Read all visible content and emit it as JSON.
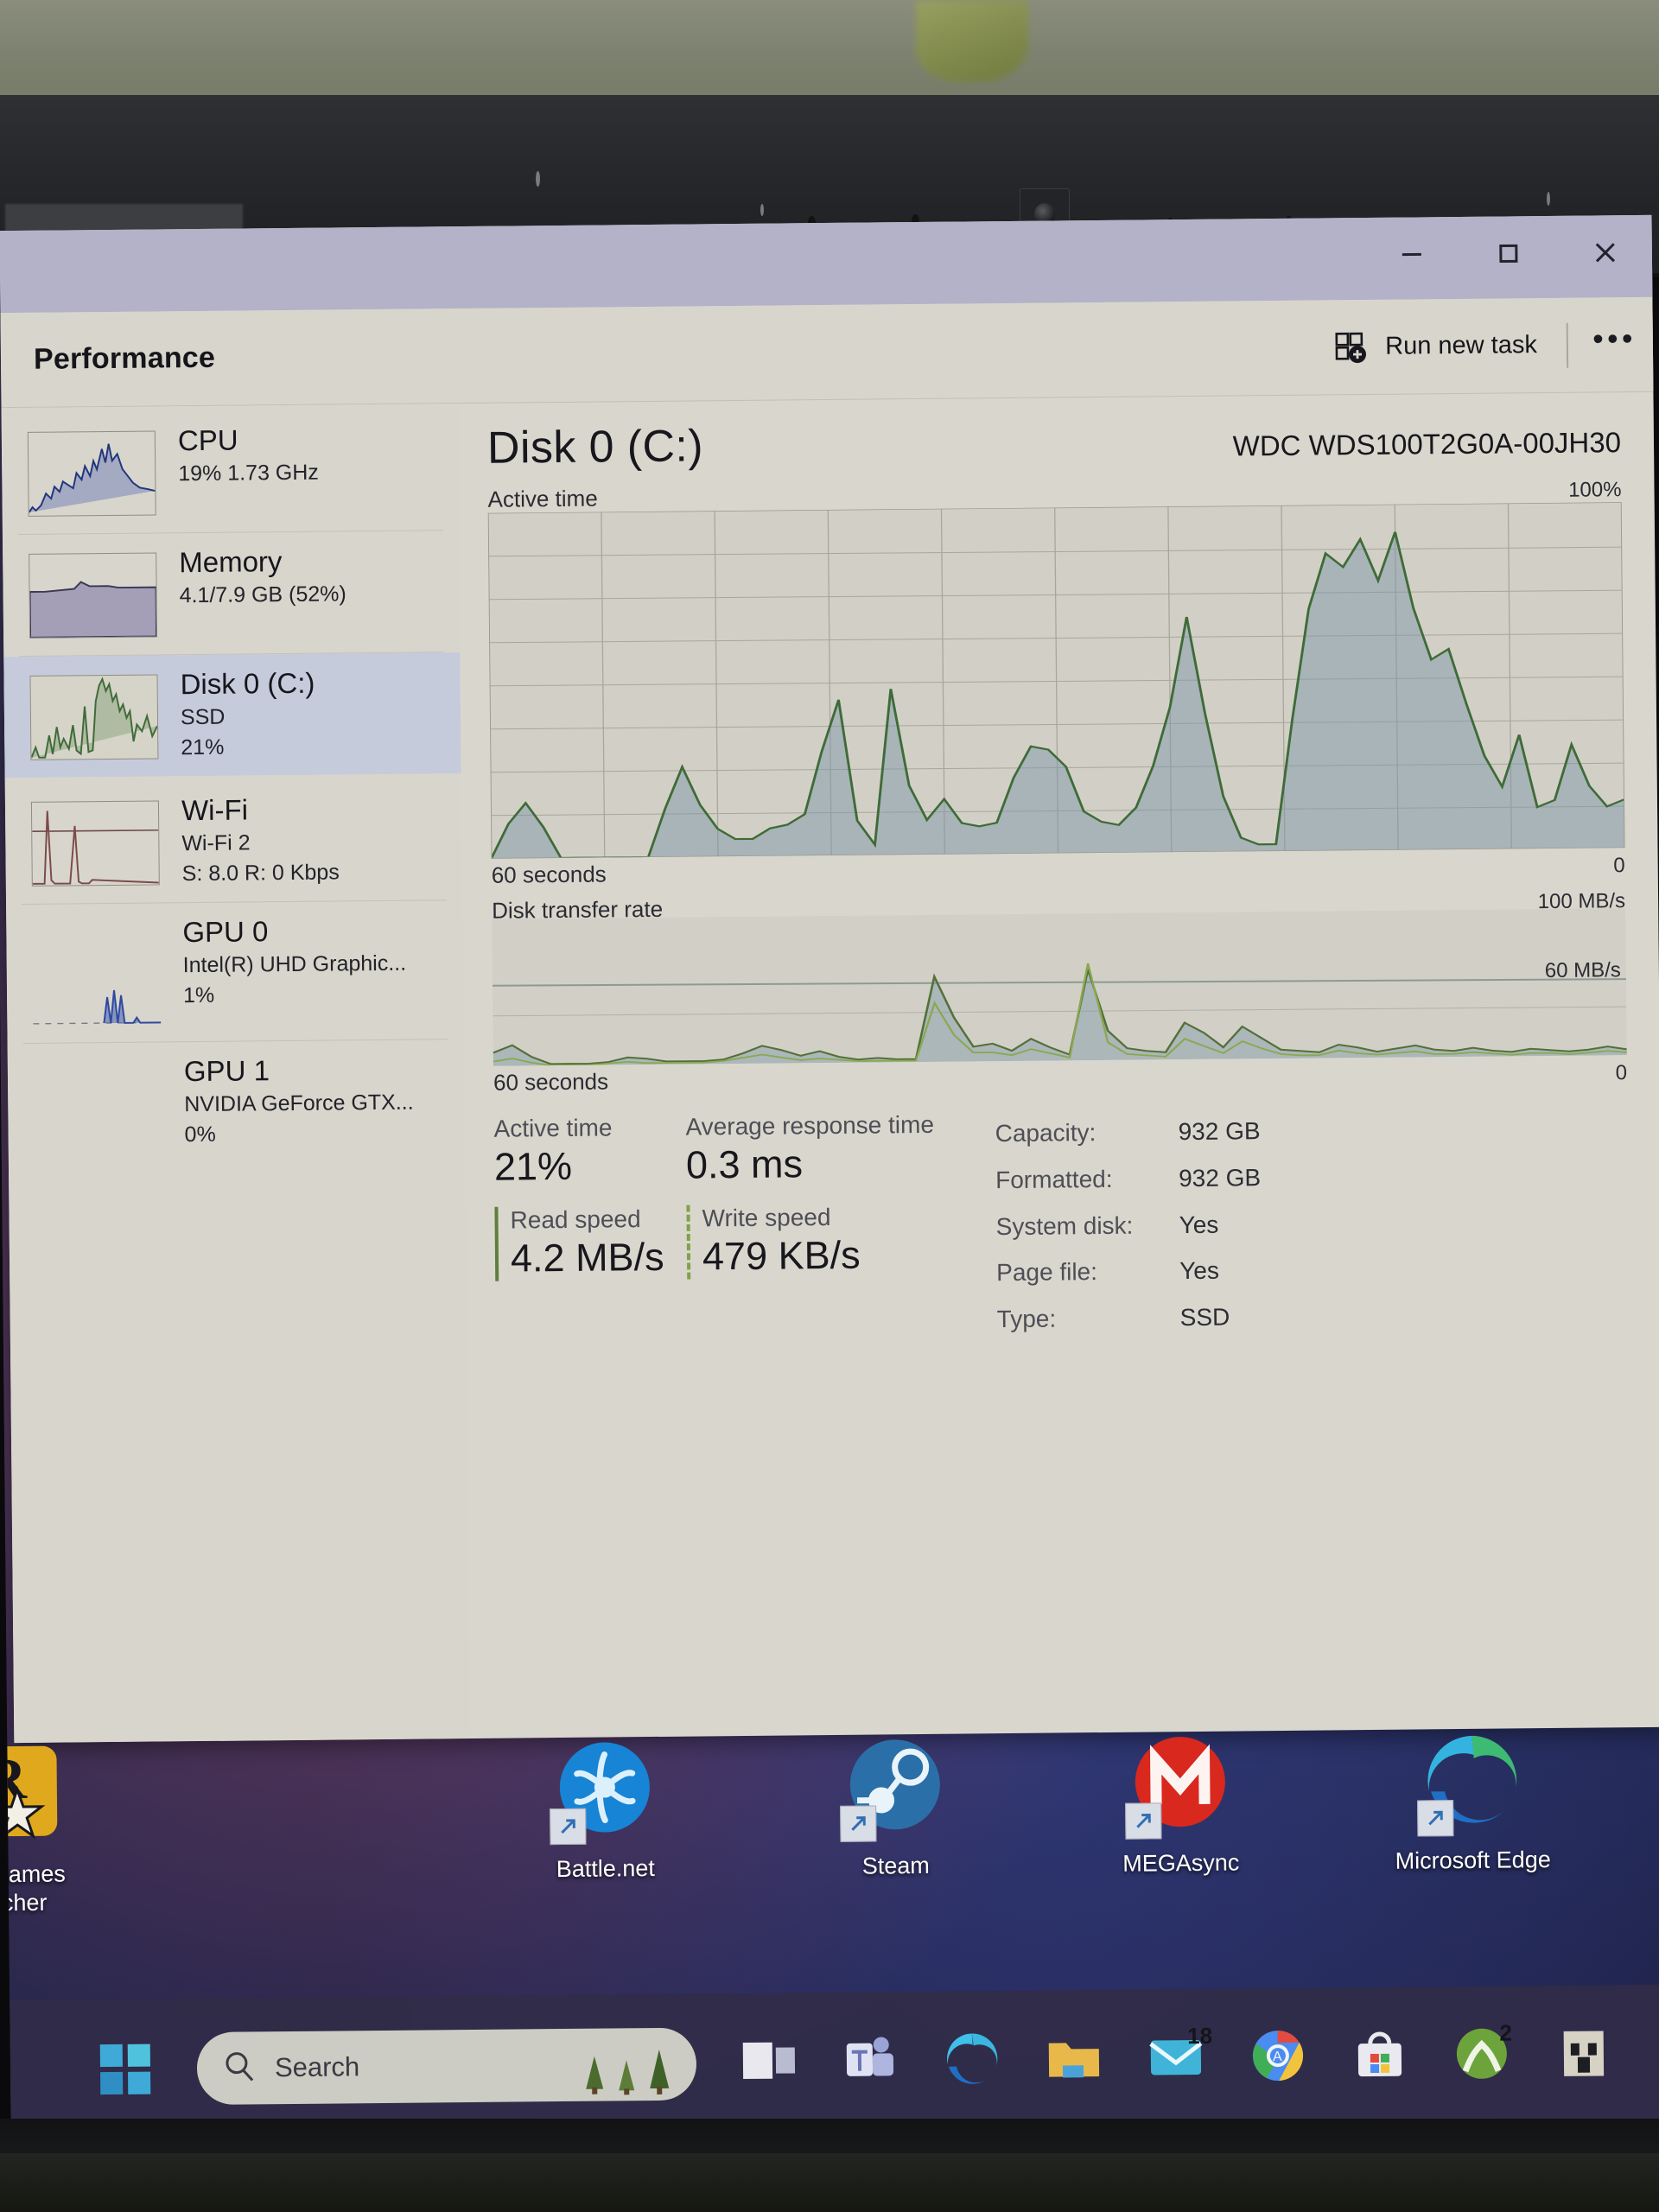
{
  "window": {
    "app_title": "Performance",
    "controls": {
      "minimize": "minimize-icon",
      "maximize": "maximize-icon",
      "close": "close-icon"
    },
    "toolbar": {
      "run_new_task_label": "Run new task",
      "run_new_task_icon": "new-task-icon",
      "more_label": "•••"
    }
  },
  "sidebar": {
    "items": [
      {
        "name": "CPU",
        "sub1": "19%  1.73 GHz",
        "sub2": "",
        "selected": false,
        "color": "#2a3f8f"
      },
      {
        "name": "Memory",
        "sub1": "4.1/7.9 GB (52%)",
        "sub2": "",
        "selected": false,
        "color": "#6a5a9a"
      },
      {
        "name": "Disk 0 (C:)",
        "sub1": "SSD",
        "sub2": "21%",
        "selected": true,
        "color": "#4e7a45"
      },
      {
        "name": "Wi-Fi",
        "sub1": "Wi-Fi 2",
        "sub2": "S: 8.0 R: 0 Kbps",
        "selected": false,
        "color": "#7a4c4c"
      },
      {
        "name": "GPU 0",
        "sub1": "Intel(R) UHD Graphic...",
        "sub2": "1%",
        "selected": false,
        "color": "#3f57a8"
      },
      {
        "name": "GPU 1",
        "sub1": "NVIDIA GeForce GTX...",
        "sub2": "0%",
        "selected": false,
        "color": "#3f57a8"
      }
    ]
  },
  "main": {
    "title": "Disk 0 (C:)",
    "model": "WDC WDS100T2G0A-00JH30",
    "active_chart": {
      "caption": "Active time",
      "max_label": "100%",
      "min_label": "0",
      "time_label": "60 seconds"
    },
    "transfer_chart": {
      "caption": "Disk transfer rate",
      "max_label": "100 MB/s",
      "mid_label": "60 MB/s",
      "min_label": "0",
      "time_label": "60 seconds"
    },
    "stats": {
      "active_time_label": "Active time",
      "active_time_value": "21%",
      "avg_response_label": "Average response time",
      "avg_response_value": "0.3 ms",
      "read_speed_label": "Read speed",
      "read_speed_value": "4.2 MB/s",
      "write_speed_label": "Write speed",
      "write_speed_value": "479 KB/s"
    },
    "properties": [
      {
        "key": "Capacity:",
        "value": "932 GB"
      },
      {
        "key": "Formatted:",
        "value": "932 GB"
      },
      {
        "key": "System disk:",
        "value": "Yes"
      },
      {
        "key": "Page file:",
        "value": "Yes"
      },
      {
        "key": "Type:",
        "value": "SSD"
      }
    ]
  },
  "chart_data": {
    "type": "area",
    "title": "Disk 0 (C:) Active time",
    "xlabel": "60 seconds",
    "ylabel": "Active time",
    "ylim": [
      0,
      100
    ],
    "grid": true,
    "series": [
      {
        "name": "Active time",
        "unit": "%",
        "color": "#4e7a45",
        "values": [
          0,
          10,
          16,
          9,
          0,
          0,
          0,
          0,
          0,
          0,
          14,
          26,
          15,
          8,
          5,
          5,
          8,
          9,
          12,
          30,
          45,
          10,
          3,
          48,
          20,
          10,
          16,
          9,
          8,
          9,
          22,
          31,
          30,
          25,
          12,
          9,
          8,
          13,
          25,
          42,
          68,
          40,
          16,
          4,
          2,
          2,
          38,
          70,
          86,
          82,
          90,
          78,
          92,
          70,
          55,
          58,
          42,
          27,
          18,
          33,
          12,
          14,
          30,
          18,
          12,
          14
        ]
      }
    ],
    "secondary": {
      "type": "area",
      "title": "Disk transfer rate",
      "xlabel": "60 seconds",
      "ylim": [
        0,
        100
      ],
      "y_ticks": [
        0,
        60,
        100
      ],
      "series": [
        {
          "name": "Read",
          "unit": "MB/s",
          "color": "#5f7f3c",
          "values": [
            9,
            14,
            6,
            1,
            1,
            1,
            2,
            5,
            4,
            2,
            2,
            2,
            3,
            7,
            12,
            9,
            5,
            8,
            4,
            2,
            3,
            2,
            2,
            58,
            30,
            10,
            12,
            7,
            15,
            9,
            4,
            62,
            20,
            8,
            6,
            5,
            25,
            18,
            8,
            22,
            14,
            6,
            5,
            4,
            9,
            7,
            4,
            6,
            8,
            5,
            4,
            6,
            4,
            3,
            5,
            4,
            3,
            4,
            6,
            4
          ]
        },
        {
          "name": "Write",
          "unit": "MB/s",
          "color": "#9ab85a",
          "values": [
            3,
            5,
            2,
            0,
            0,
            0,
            1,
            2,
            1,
            1,
            1,
            1,
            2,
            4,
            6,
            4,
            2,
            3,
            2,
            1,
            1,
            1,
            1,
            40,
            18,
            6,
            6,
            4,
            8,
            5,
            2,
            66,
            12,
            4,
            3,
            2,
            14,
            9,
            4,
            12,
            7,
            3,
            2,
            2,
            5,
            3,
            2,
            3,
            4,
            2,
            2,
            3,
            2,
            1,
            2,
            2,
            1,
            2,
            3,
            2
          ]
        }
      ]
    }
  },
  "desktop": {
    "icons": [
      {
        "label": "Rockstar Games\nLauncher",
        "icon": "rockstar-games-icon"
      },
      {
        "label": "Battle.net",
        "icon": "battlenet-icon"
      },
      {
        "label": "Steam",
        "icon": "steam-icon"
      },
      {
        "label": "MEGAsync",
        "icon": "megasync-icon"
      },
      {
        "label": "Microsoft Edge",
        "icon": "microsoft-edge-icon"
      }
    ]
  },
  "taskbar": {
    "start_icon": "windows-start-icon",
    "search_placeholder": "Search",
    "search_icon": "search-icon",
    "items": [
      {
        "name": "task-view-icon",
        "badge": ""
      },
      {
        "name": "microsoft-teams-icon",
        "badge": ""
      },
      {
        "name": "microsoft-edge-icon",
        "badge": ""
      },
      {
        "name": "file-explorer-icon",
        "badge": ""
      },
      {
        "name": "mail-icon",
        "badge": "18"
      },
      {
        "name": "google-chrome-icon",
        "badge": ""
      },
      {
        "name": "microsoft-store-icon",
        "badge": ""
      },
      {
        "name": "xbox-icon",
        "badge": "2"
      },
      {
        "name": "minecraft-icon",
        "badge": ""
      },
      {
        "name": "spotify-icon",
        "badge": ""
      }
    ]
  }
}
